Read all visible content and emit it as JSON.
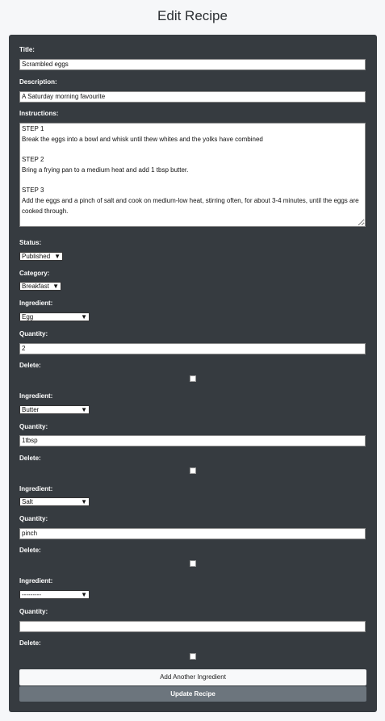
{
  "page": {
    "title": "Edit Recipe"
  },
  "form": {
    "title_label": "Title:",
    "title_value": "Scrambled eggs",
    "description_label": "Description:",
    "description_value": "A Saturday morning favourite",
    "instructions_label": "Instructions:",
    "instructions_value": "STEP 1\nBreak the eggs into a bowl and whisk until thew whites and the yolks have combined\n\nSTEP 2\nBring a frying pan to a medium heat and add 1 tbsp butter.\n\nSTEP 3\nAdd the eggs and a pinch of salt and cook on medium-low heat, stirring often, for about 3-4 minutes, until the eggs are cooked through.",
    "status_label": "Status:",
    "status_value": "Published",
    "category_label": "Category:",
    "category_value": "Breakfast",
    "ingredients": [
      {
        "ingredient_label": "Ingredient:",
        "ingredient_value": "Egg",
        "quantity_label": "Quantity:",
        "quantity_value": "2",
        "delete_label": "Delete:"
      },
      {
        "ingredient_label": "Ingredient:",
        "ingredient_value": "Butter",
        "quantity_label": "Quantity:",
        "quantity_value": "1tbsp",
        "delete_label": "Delete:"
      },
      {
        "ingredient_label": "Ingredient:",
        "ingredient_value": "Salt",
        "quantity_label": "Quantity:",
        "quantity_value": "pinch",
        "delete_label": "Delete:"
      },
      {
        "ingredient_label": "Ingredient:",
        "ingredient_value": "---------",
        "quantity_label": "Quantity:",
        "quantity_value": "",
        "delete_label": "Delete:"
      }
    ],
    "add_ingredient_label": "Add Another Ingredient",
    "update_label": "Update Recipe"
  },
  "icons": {
    "select_arrow": "chevron-down-icon"
  }
}
